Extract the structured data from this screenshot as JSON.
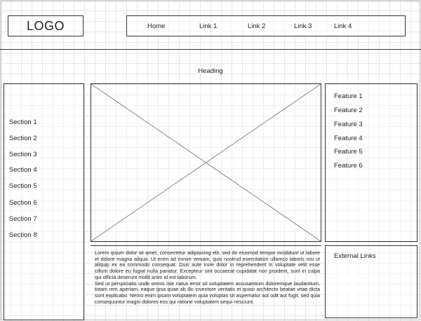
{
  "header": {
    "logo": "LOGO",
    "nav": [
      "Home",
      "Link 1",
      "Link 2",
      "Link 3",
      "Link 4"
    ]
  },
  "main": {
    "heading": "Heading",
    "paragraph1": "Lorem ipsum dolor sit amet, consectetur adipisicing elit, sed do eiusmod tempor incididunt ut labore et dolore magna aliqua. Ut enim ad minim veniam, quis nostrud exercitation ullamco laboris nisi ut aliquip ex ea commodo consequat. Duis aute irure dolor in reprehenderit in voluptate velit esse cillum dolore eu fugiat nulla pariatur. Excepteur sint occaecat cupidatat non proident, sunt in culpa qui officia deserunt mollit anim id est laborum.",
    "paragraph2": "Sed ut perspiciatis unde omnis iste natus error sit voluptatem accusantium doloremque laudantium, totam rem aperiam, eaque ipsa quae ab illo inventore veritatis et quasi architecto beatae vitae dicta sunt explicabo. Nemo enim ipsam voluptatem quia voluptas sit aspernatur aut odit aut fugit, sed quia consequuntur magni dolores eos qui ratione voluptatem sequi nesciunt."
  },
  "sidebar": {
    "sections": [
      "Section 1",
      "Section 2",
      "Section 3",
      "Section 4",
      "Section 5",
      "Section 6",
      "Section 7",
      "Section 8"
    ]
  },
  "features": {
    "items": [
      "Feature 1",
      "Feature 2",
      "Feature 3",
      "Feature 4",
      "Feature 5",
      "Feature 6"
    ]
  },
  "external": {
    "label": "External Links"
  }
}
